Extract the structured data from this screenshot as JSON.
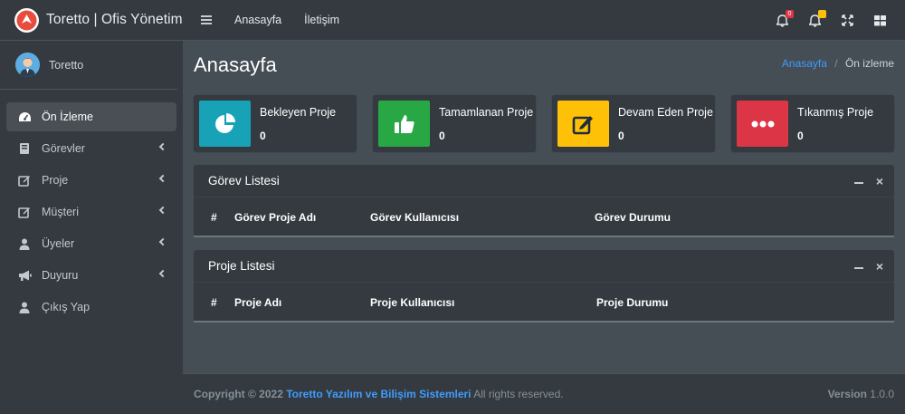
{
  "brand": {
    "title": "Toretto | Ofis Yönetim"
  },
  "user": {
    "name": "Toretto"
  },
  "sidebar": {
    "items": [
      {
        "label": "Ön İzleme",
        "icon": "dashboard-icon",
        "active": true,
        "has_arrow": false
      },
      {
        "label": "Görevler",
        "icon": "book-icon",
        "active": false,
        "has_arrow": true
      },
      {
        "label": "Proje",
        "icon": "edit-icon",
        "active": false,
        "has_arrow": true
      },
      {
        "label": "Müşteri",
        "icon": "edit-icon",
        "active": false,
        "has_arrow": true
      },
      {
        "label": "Üyeler",
        "icon": "user-icon",
        "active": false,
        "has_arrow": true
      },
      {
        "label": "Duyuru",
        "icon": "megaphone-icon",
        "active": false,
        "has_arrow": true
      },
      {
        "label": "Çıkış Yap",
        "icon": "user-icon",
        "active": false,
        "has_arrow": false
      }
    ]
  },
  "topbar": {
    "links": [
      "Anasayfa",
      "İletişim"
    ],
    "notifications_badge": "0",
    "alerts_badge": "",
    "colors": {
      "danger": "#dc3545",
      "warning": "#ffc107"
    }
  },
  "page": {
    "title": "Anasayfa",
    "breadcrumb": {
      "home": "Anasayfa",
      "separator": "/",
      "current": "Ön izleme"
    }
  },
  "info_boxes": [
    {
      "label": "Bekleyen Proje",
      "value": "0",
      "icon": "pie-chart-icon",
      "color": "#17a2b8"
    },
    {
      "label": "Tamamlanan Proje",
      "value": "0",
      "icon": "thumbs-up-icon",
      "color": "#28a745"
    },
    {
      "label": "Devam Eden Proje",
      "value": "0",
      "icon": "edit-icon",
      "color": "#ffc107"
    },
    {
      "label": "Tıkanmış Proje",
      "value": "0",
      "icon": "ellipsis-icon",
      "color": "#dc3545"
    }
  ],
  "task_list": {
    "title": "Görev Listesi",
    "columns": [
      "#",
      "Görev Proje Adı",
      "Görev Kullanıcısı",
      "Görev Durumu"
    ]
  },
  "project_list": {
    "title": "Proje Listesi",
    "columns": [
      "#",
      "Proje Adı",
      "Proje Kullanıcısı",
      "Proje Durumu"
    ]
  },
  "footer": {
    "copyright_prefix": "Copyright © 2022",
    "company": "Toretto Yazılım ve Bilişim Sistemleri",
    "rights": "All rights reserved.",
    "version_label": "Version",
    "version": "1.0.0"
  }
}
